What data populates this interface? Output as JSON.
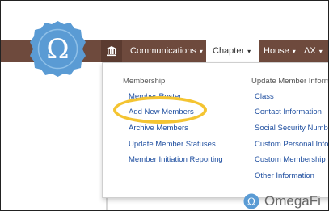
{
  "nav": {
    "home_icon": "building-columns-icon",
    "items": [
      {
        "label": "Communications",
        "caret": "▾"
      },
      {
        "label": "Chapter",
        "caret": "▾"
      },
      {
        "label": "House",
        "caret": "▾"
      },
      {
        "label": "ΔX",
        "caret": "▾"
      }
    ]
  },
  "logo": {
    "glyph": "Ω",
    "color": "#5a9bd4"
  },
  "dropdown": {
    "col1_heading": "Membership",
    "col1_items": [
      "Member Roster",
      "Add New Members",
      "Archive Members",
      "Update Member Statuses",
      "Member Initiation Reporting"
    ],
    "col2_heading": "Update Member Information",
    "col2_items": [
      "Class",
      "Contact Information",
      "Social Security Number",
      "Custom Personal Information",
      "Custom Membership",
      "Other Information"
    ]
  },
  "below": {
    "brand_text": "OmegaFi"
  },
  "colors": {
    "navbar": "#6e4a3d",
    "link": "#1f4fa0",
    "highlight": "#f4c431"
  }
}
